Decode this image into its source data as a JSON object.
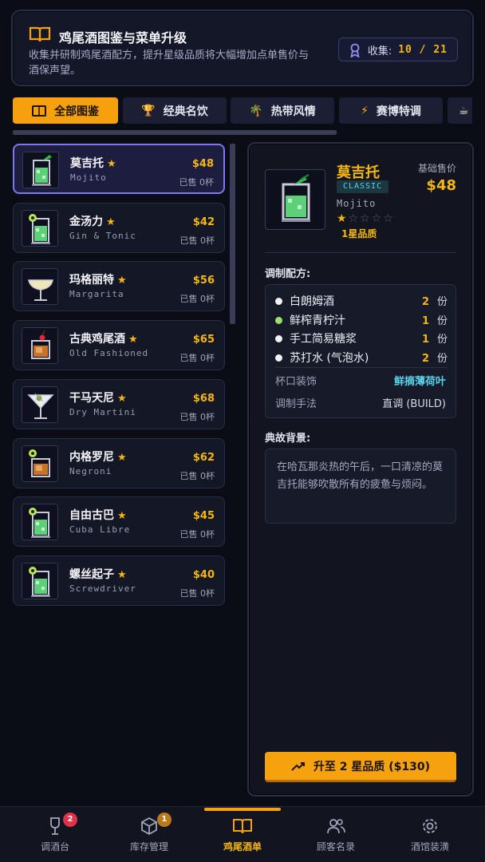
{
  "header": {
    "title": "鸡尾酒图鉴与菜单升级",
    "description": "收集并研制鸡尾酒配方，提升星级品质将大幅增加点单售价与酒保声望。",
    "collect_label": "收集:",
    "collect_value": "10 / 21",
    "book_icon": "book-icon",
    "collect_icon": "ribbon-icon"
  },
  "tabs": [
    {
      "label": "全部图鉴",
      "icon": "book-icon",
      "active": true
    },
    {
      "label": "经典名饮",
      "icon": "trophy-icon",
      "active": false
    },
    {
      "label": "热带风情",
      "icon": "palm-icon",
      "active": false
    },
    {
      "label": "赛博特调",
      "icon": "lightning-icon",
      "active": false
    },
    {
      "label": "",
      "icon": "coffee-icon",
      "active": false
    }
  ],
  "cocktails": [
    {
      "name": "莫吉托",
      "en": "Mojito",
      "price": "$48",
      "sold": "已售 0杯",
      "glass": "highball",
      "garnish": "mint"
    },
    {
      "name": "金汤力",
      "en": "Gin & Tonic",
      "price": "$42",
      "sold": "已售 0杯",
      "glass": "highball",
      "garnish": "lime"
    },
    {
      "name": "玛格丽特",
      "en": "Margarita",
      "price": "$56",
      "sold": "已售 0杯",
      "glass": "coupe",
      "garnish": "none"
    },
    {
      "name": "古典鸡尾酒",
      "en": "Old Fashioned",
      "price": "$65",
      "sold": "已售 0杯",
      "glass": "rocks",
      "garnish": "cherry"
    },
    {
      "name": "干马天尼",
      "en": "Dry Martini",
      "price": "$68",
      "sold": "已售 0杯",
      "glass": "martini",
      "garnish": "olive"
    },
    {
      "name": "内格罗尼",
      "en": "Negroni",
      "price": "$62",
      "sold": "已售 0杯",
      "glass": "rocks",
      "garnish": "lime"
    },
    {
      "name": "自由古巴",
      "en": "Cuba Libre",
      "price": "$45",
      "sold": "已售 0杯",
      "glass": "highball",
      "garnish": "lime"
    },
    {
      "name": "螺丝起子",
      "en": "Screwdriver",
      "price": "$40",
      "sold": "已售 0杯",
      "glass": "highball",
      "garnish": "lime"
    }
  ],
  "detail": {
    "name": "莫吉托",
    "tag": "CLASSIC",
    "en": "Mojito",
    "stars_filled": 1,
    "stars_total": 5,
    "quality": "1星品质",
    "base_price_label": "基础售价",
    "price": "$48",
    "recipe_title": "调制配方:",
    "ingredients": [
      {
        "name": "白朗姆酒",
        "qty": "2",
        "unit": "份",
        "dot": "#f1f1f6"
      },
      {
        "name": "鲜榨青柠汁",
        "qty": "1",
        "unit": "份",
        "dot": "#9be26a"
      },
      {
        "name": "手工简易糖浆",
        "qty": "1",
        "unit": "份",
        "dot": "#f1f1f6"
      },
      {
        "name": "苏打水 (气泡水)",
        "qty": "2",
        "unit": "份",
        "dot": "#f1f1f6"
      }
    ],
    "garnish_label": "杯口装饰",
    "garnish_value": "鲜摘薄荷叶",
    "method_label": "调制手法",
    "method_value": "直调 (BUILD)",
    "story_title": "典故背景:",
    "story": "在哈瓦那炎热的午后，一口清凉的莫吉托能够吹散所有的疲惫与烦闷。",
    "upgrade_label": "升至 2 星品质 ($130)",
    "upgrade_icon": "trending-up-icon"
  },
  "nav": [
    {
      "label": "调酒台",
      "icon": "wine-glass-icon",
      "badge": "2",
      "badge_color": "#e0324b",
      "active": false
    },
    {
      "label": "库存管理",
      "icon": "box-icon",
      "badge": "1",
      "badge_color": "#b87a1c",
      "active": false
    },
    {
      "label": "鸡尾酒单",
      "icon": "book-icon",
      "badge": "",
      "active": true
    },
    {
      "label": "顾客名录",
      "icon": "users-icon",
      "badge": "",
      "active": false
    },
    {
      "label": "酒馆装潢",
      "icon": "gear-icon",
      "badge": "",
      "active": false
    }
  ],
  "colors": {
    "accent": "#f5a20e",
    "selected_border": "#7c78ee",
    "tag": "#59d2e8",
    "garnish": "#59d2e8"
  }
}
